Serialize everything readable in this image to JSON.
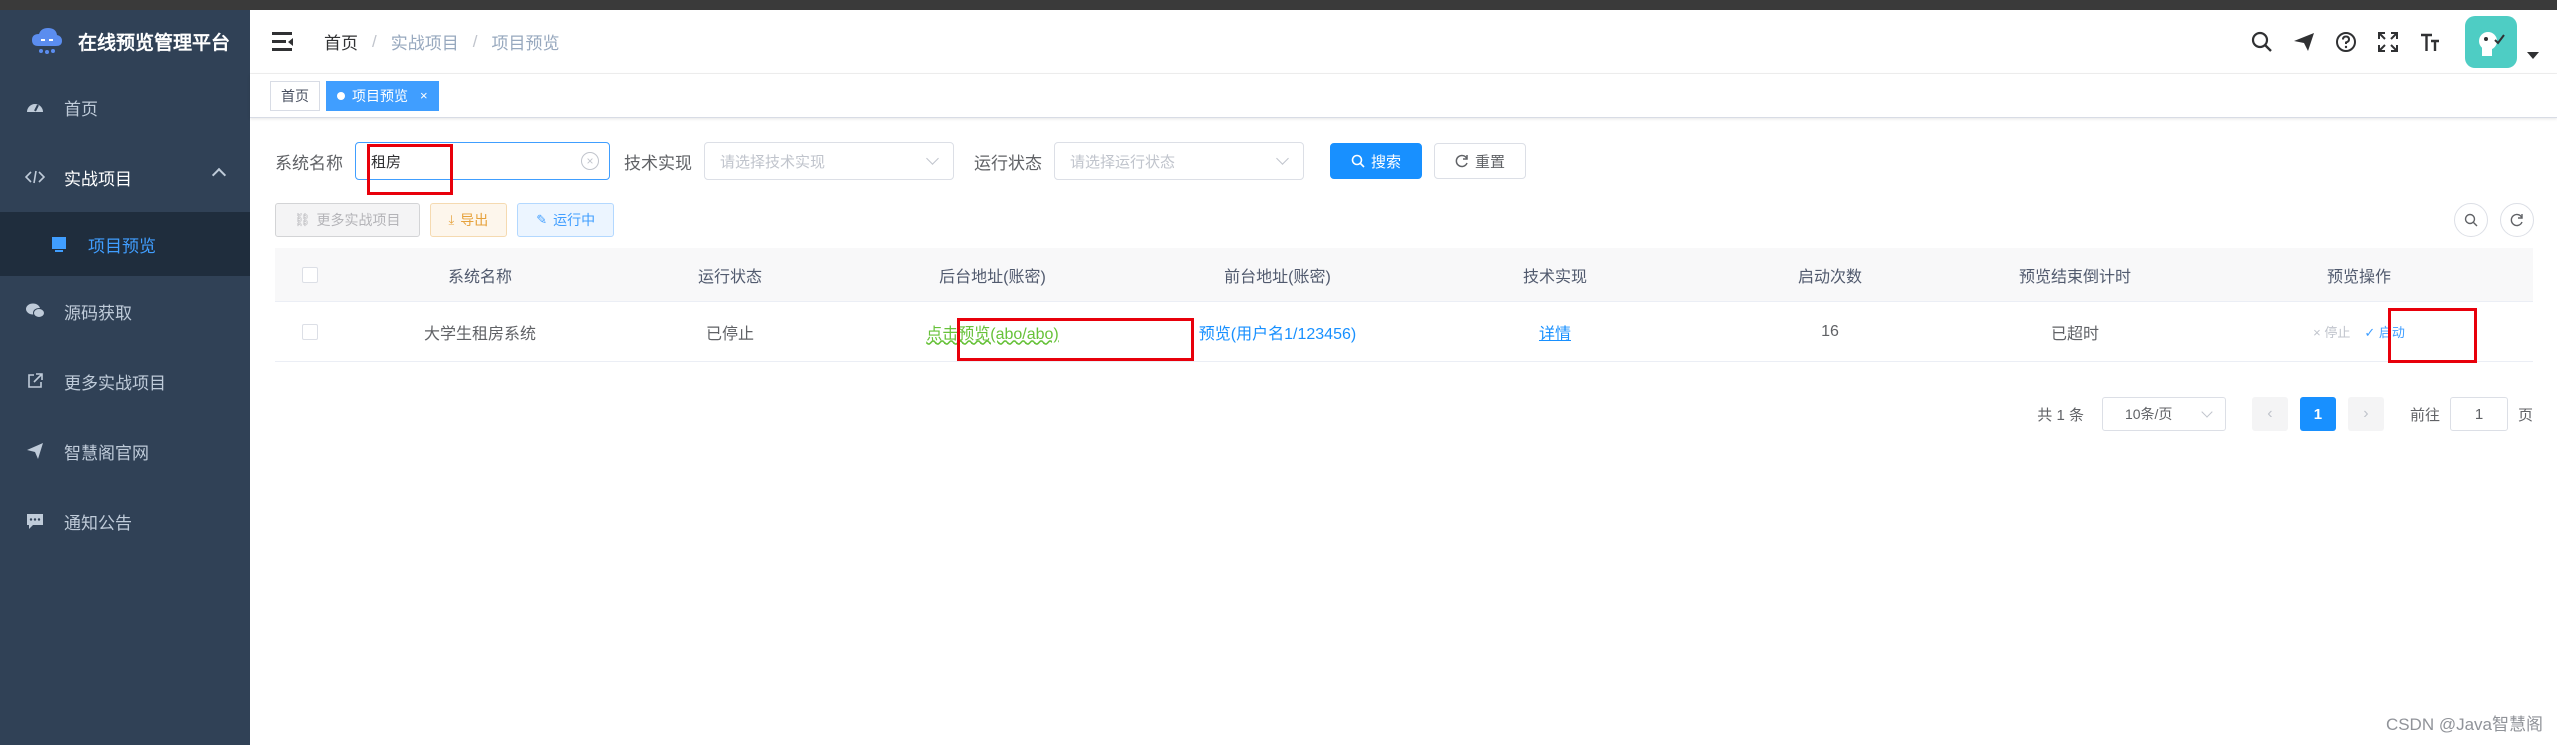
{
  "app": {
    "title": "在线预览管理平台"
  },
  "sidebar": {
    "items": [
      {
        "label": "首页",
        "icon": "dashboard-icon"
      },
      {
        "label": "实战项目",
        "icon": "code-icon",
        "open": true
      },
      {
        "label": "源码获取",
        "icon": "wechat-icon"
      },
      {
        "label": "更多实战项目",
        "icon": "external-link-icon"
      },
      {
        "label": "智慧阁官网",
        "icon": "send-icon"
      },
      {
        "label": "通知公告",
        "icon": "message-icon"
      }
    ],
    "submenu": [
      {
        "label": "项目预览",
        "icon": "monitor-icon"
      }
    ]
  },
  "breadcrumb": [
    "首页",
    "实战项目",
    "项目预览"
  ],
  "breadcrumb_sep": "/",
  "tags": [
    {
      "label": "首页"
    },
    {
      "label": "项目预览",
      "close": "×"
    }
  ],
  "search": {
    "name_label": "系统名称",
    "name_value": "租房",
    "tech_label": "技术实现",
    "tech_placeholder": "请选择技术实现",
    "status_label": "运行状态",
    "status_placeholder": "请选择运行状态",
    "search_button": "搜索",
    "reset_button": "重置"
  },
  "toolbar": {
    "more_button": "更多实战项目",
    "export_button": "导出",
    "running_button": "运行中"
  },
  "table": {
    "headers": [
      "系统名称",
      "运行状态",
      "后台地址(账密)",
      "前台地址(账密)",
      "技术实现",
      "启动次数",
      "预览结束倒计时",
      "预览操作"
    ],
    "rows": [
      {
        "name": "大学生租房系统",
        "status": "已停止",
        "backend": "点击预览(abo/abo)",
        "frontend": "预览(用户名1/123456)",
        "tech": "详情",
        "count": "16",
        "countdown": "已超时",
        "op_stop": "× 停止",
        "op_start": "✓ 启动"
      }
    ]
  },
  "pagination": {
    "total": "共 1 条",
    "page_size": "10条/页",
    "current": "1",
    "goto_label": "前往",
    "goto_value": "1",
    "page_suffix": "页"
  },
  "watermark": "CSDN @Java智慧阁",
  "colors": {
    "sidebar_bg": "#304156",
    "primary": "#1890ff",
    "annotation": "#e8000b"
  }
}
